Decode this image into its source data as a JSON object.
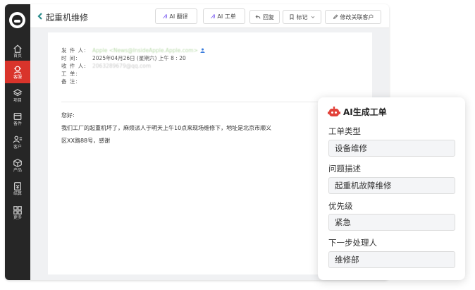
{
  "sidebar": {
    "items": [
      {
        "label": "首页",
        "icon": "home-icon"
      },
      {
        "label": "客服",
        "icon": "customer-service-icon"
      },
      {
        "label": "项目",
        "icon": "layers-icon"
      },
      {
        "label": "备件",
        "icon": "inventory-icon"
      },
      {
        "label": "客户",
        "icon": "customer-icon"
      },
      {
        "label": "产品",
        "icon": "cube-icon"
      },
      {
        "label": "结算",
        "icon": "settlement-icon"
      },
      {
        "label": "更多",
        "icon": "grid-icon"
      }
    ],
    "active_index": 1
  },
  "header": {
    "title": "起重机维修",
    "buttons": {
      "ai_translate": "AI 翻译",
      "ai_ticket": "AI 工单",
      "reply": "回复",
      "mark": "标记",
      "edit_customer": "修改关联客户"
    }
  },
  "email": {
    "meta": [
      {
        "label": "发  件  人:",
        "value": "Apple <News@InsideApple.Apple.com>"
      },
      {
        "label": "时      间:",
        "value": "2025年04月26日 (星期六) 上午 8 : 20"
      },
      {
        "label": "收  件  人:",
        "value": "2063289679@qq.com"
      },
      {
        "label": "工      单:",
        "value": ""
      },
      {
        "label": "备      注:",
        "value": ""
      }
    ],
    "body": {
      "greeting": "您好:",
      "line1": "我们工厂的起重机坏了，麻烦派人于明天上午10点来现场维修下，地址是北京市顺义",
      "line2": "区XX路88号，感谢"
    }
  },
  "ai_panel": {
    "title": "AI生成工单",
    "fields": [
      {
        "label": "工单类型",
        "value": "设备维修"
      },
      {
        "label": "问题描述",
        "value": "起重机故障维修"
      },
      {
        "label": "优先级",
        "value": "紧急"
      },
      {
        "label": "下一步处理人",
        "value": "维修部"
      }
    ]
  },
  "colors": {
    "sidebar_bg": "#262626",
    "active_red": "#d9342b",
    "ai_purple": "#7a5cf0",
    "back_teal": "#2a8c8c",
    "robot_red": "#e2423a"
  }
}
